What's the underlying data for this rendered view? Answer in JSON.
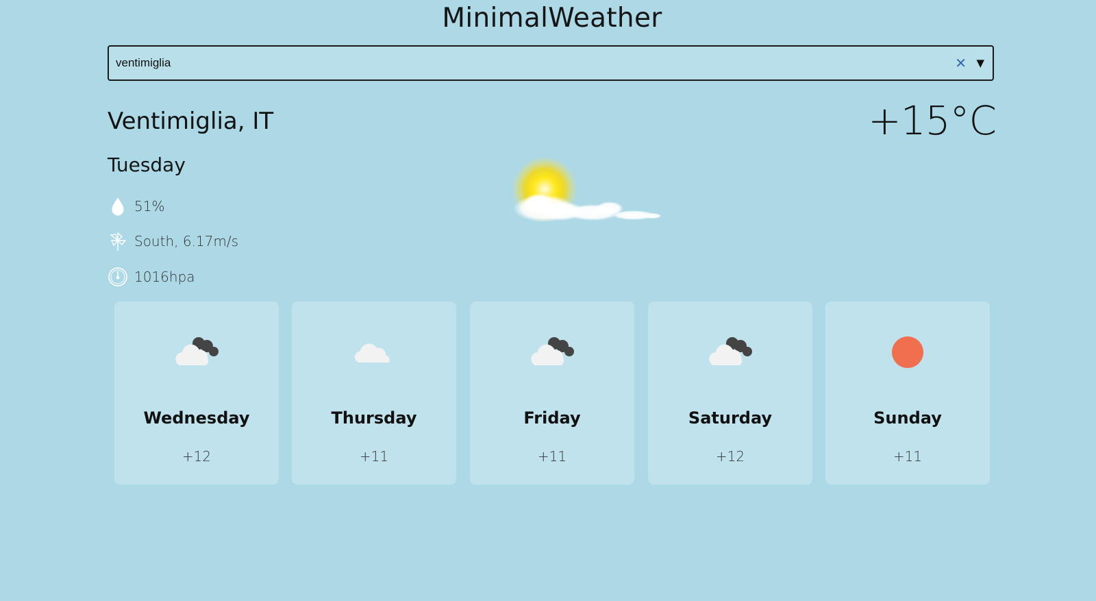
{
  "app": {
    "title": "MinimalWeather"
  },
  "search": {
    "value": "ventimiglia",
    "clear_icon": "clear-x-icon",
    "dropdown_icon": "chevron-down-icon"
  },
  "current": {
    "location": "Ventimiglia, IT",
    "temperature": "+15°C",
    "day": "Tuesday",
    "condition_icon": "sun-behind-cloud-icon",
    "humidity": {
      "icon": "water-drop-icon",
      "text": "51%"
    },
    "wind": {
      "icon": "pinwheel-icon",
      "text": "South, 6.17m/s"
    },
    "pressure": {
      "icon": "barometer-icon",
      "text": "1016hpa"
    }
  },
  "forecast": [
    {
      "day": "Wednesday",
      "temp": "+12",
      "icon": "cloud-dark-clouds-icon"
    },
    {
      "day": "Thursday",
      "temp": "+11",
      "icon": "cloud-icon"
    },
    {
      "day": "Friday",
      "temp": "+11",
      "icon": "cloud-dark-clouds-icon"
    },
    {
      "day": "Saturday",
      "temp": "+12",
      "icon": "cloud-dark-clouds-icon"
    },
    {
      "day": "Sunday",
      "temp": "+11",
      "icon": "sun-icon"
    }
  ],
  "colors": {
    "background": "#add8e6",
    "card": "#bfe2ec",
    "search_bg": "#b9dfea",
    "sun_orange": "#ef6f4f",
    "clear_blue": "#3366aa"
  }
}
